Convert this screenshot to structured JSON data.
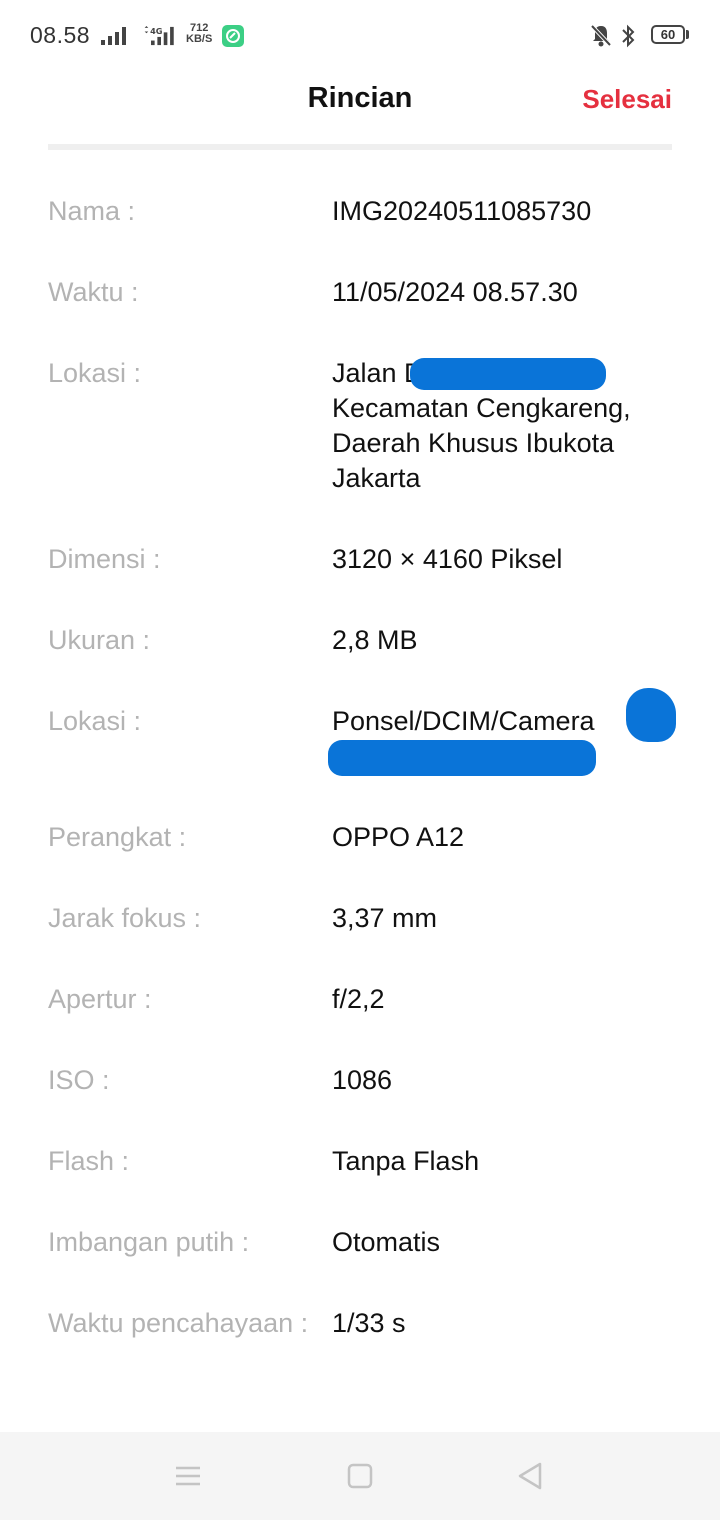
{
  "status_bar": {
    "time": "08.58",
    "network_type": "4G",
    "net_speed_value": "712",
    "net_speed_unit": "KB/S",
    "battery": "60"
  },
  "header": {
    "title": "Rincian",
    "done_label": "Selesai"
  },
  "details": [
    {
      "label": "Nama :",
      "value": "IMG20240511085730"
    },
    {
      "label": "Waktu :",
      "value": "11/05/2024 08.57.30"
    },
    {
      "label": "Lokasi :",
      "value": "Jalan                              Duri Kosambi, Kecamatan Cengkareng, Daerah Khusus Ibukota Jakarta"
    },
    {
      "label": "Dimensi :",
      "value": "3120 × 4160 Piksel"
    },
    {
      "label": "Ukuran :",
      "value": "2,8 MB"
    },
    {
      "label": "Lokasi :",
      "value": "Ponsel/DCIM/Camera                                    .jpg"
    },
    {
      "label": "Perangkat :",
      "value": "OPPO A12"
    },
    {
      "label": "Jarak fokus :",
      "value": "3,37 mm"
    },
    {
      "label": "Apertur :",
      "value": "f/2,2"
    },
    {
      "label": "ISO :",
      "value": "1086"
    },
    {
      "label": "Flash :",
      "value": "Tanpa Flash"
    },
    {
      "label": "Imbangan putih :",
      "value": "Otomatis"
    },
    {
      "label": "Waktu pencahayaan :",
      "value": "1/33 s"
    }
  ],
  "colors": {
    "accent": "#e5303f",
    "label": "#b3b3b3",
    "value": "#111111",
    "redaction": "#0a74d8"
  },
  "nav_bar": {
    "icons": [
      "menu-icon",
      "home-square-icon",
      "back-triangle-icon"
    ]
  }
}
